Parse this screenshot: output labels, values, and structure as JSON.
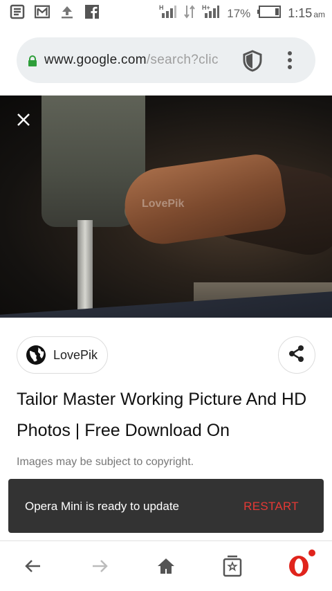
{
  "status_bar": {
    "left_icons": [
      "notes-icon",
      "gmail-icon",
      "upload-icon",
      "facebook-icon"
    ],
    "signal1_label": "H",
    "signal2_label": "H+",
    "battery": "17%",
    "time": "1:15",
    "ampm": "am"
  },
  "url_bar": {
    "host": "www.google.com",
    "path": "/search?clic",
    "secure": true
  },
  "photo": {
    "watermark": "LovePik"
  },
  "result": {
    "source": "LovePik",
    "title": "Tailor Master Working Picture And HD Photos | Free Download On",
    "copyright": "Images may be subject to copyright."
  },
  "snackbar": {
    "message": "Opera Mini is ready to update",
    "action": "RESTART"
  },
  "bottom_nav": {
    "items": [
      "back-icon",
      "forward-icon",
      "home-icon",
      "tabs-icon",
      "opera-menu-icon"
    ]
  },
  "colors": {
    "accent_red": "#e0241c",
    "secure_green": "#2e9e3a",
    "snackbar_bg": "#333333"
  }
}
